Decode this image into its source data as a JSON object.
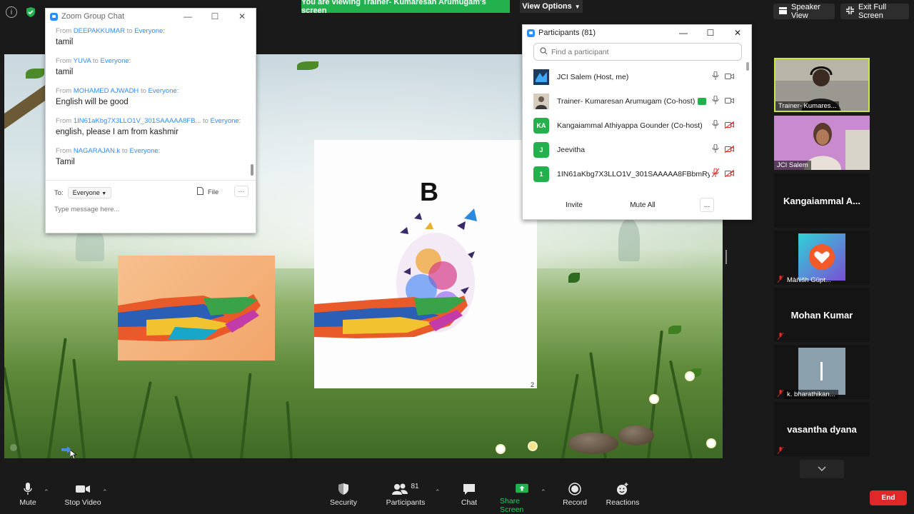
{
  "banner": {
    "viewing": "You are viewing Trainer- Kumaresan Arumugam's screen",
    "view_options": "View Options"
  },
  "top_right": {
    "speaker_view": "Speaker View",
    "exit_full_screen": "Exit Full Screen"
  },
  "slide": {
    "letter": "B",
    "page_number": "2"
  },
  "chat": {
    "title": "Zoom Group Chat",
    "messages": [
      {
        "from_label": "From",
        "sender": "DEEPAKKUMAR",
        "to_label": "to",
        "recipient": "Everyone:",
        "text": "tamil"
      },
      {
        "from_label": "From",
        "sender": "YUVA",
        "to_label": "to",
        "recipient": "Everyone:",
        "text": "tamil"
      },
      {
        "from_label": "From",
        "sender": "MOHAMED AJWADH",
        "to_label": "to",
        "recipient": "Everyone:",
        "text": "English will be good"
      },
      {
        "from_label": "From",
        "sender": "1IN61aKbg7X3LLO1V_301SAAAAA8FB...",
        "to_label": "to",
        "recipient": "Everyone:",
        "text": "english, please I am from kashmir"
      },
      {
        "from_label": "From",
        "sender": "NAGARAJAN.k",
        "to_label": "to",
        "recipient": "Everyone:",
        "text": "Tamil"
      }
    ],
    "to_label": "To:",
    "to_value": "Everyone",
    "file_label": "File",
    "more_label": "···",
    "input_placeholder": "Type message here..."
  },
  "participants": {
    "title": "Participants (81)",
    "search_placeholder": "Find a participant",
    "list": [
      {
        "avatar": "",
        "avatar_color": "#1d3b5e",
        "name": "JCI Salem (Host, me)"
      },
      {
        "avatar": "",
        "avatar_color": "#6b5a4a",
        "name": "Trainer- Kumaresan Arumugam (Co-host)"
      },
      {
        "avatar": "KA",
        "avatar_color": "#23b14d",
        "name": "Kangaiammal Athiyappa Gounder (Co-host)"
      },
      {
        "avatar": "J",
        "avatar_color": "#23b14d",
        "name": "Jeevitha"
      },
      {
        "avatar": "1",
        "avatar_color": "#23b14d",
        "name": "1IN61aKbg7X3LLO1V_301SAAAAA8FBbmRy..."
      }
    ],
    "invite": "Invite",
    "mute_all": "Mute All",
    "more": "..."
  },
  "gallery": [
    {
      "name": "Trainer- Kumares...",
      "big": ""
    },
    {
      "name": "JCI Salem",
      "big": ""
    },
    {
      "name": "",
      "big": "Kangaiammal  A..."
    },
    {
      "name": "Màňišh Güpt...",
      "big": ""
    },
    {
      "name": "",
      "big": "Mohan Kumar"
    },
    {
      "name": "k. bharathikan...",
      "big": ""
    },
    {
      "name": "",
      "big": "vasantha dyana"
    }
  ],
  "toolbar": {
    "mute": "Mute",
    "stop_video": "Stop Video",
    "security": "Security",
    "participants": "Participants",
    "participants_count": "81",
    "chat": "Chat",
    "share_screen": "Share Screen",
    "record": "Record",
    "reactions": "Reactions",
    "end": "End"
  },
  "colors": {
    "zoom_blue": "#2d8cff",
    "share_green": "#23b14d",
    "end_red": "#e02828"
  }
}
